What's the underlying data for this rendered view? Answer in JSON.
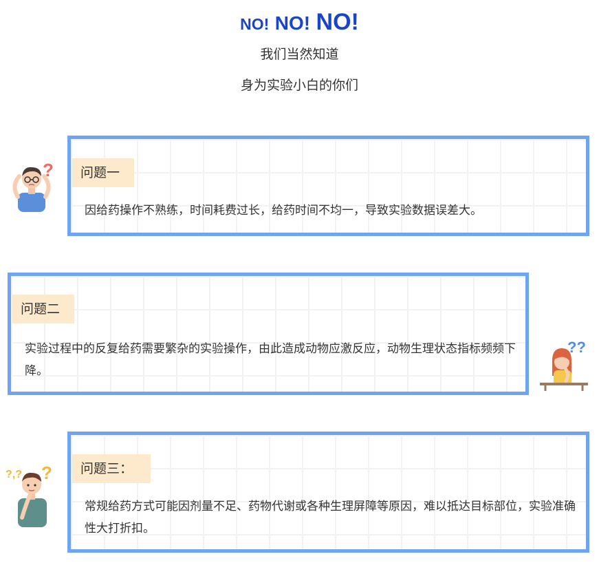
{
  "header": {
    "no_small": "NO!",
    "no_medium": "NO!",
    "no_large": "NO!",
    "line1": "我们当然知道",
    "line2": "身为实验小白的你们"
  },
  "problems": [
    {
      "tag": "问题一",
      "text": "因给药操作不熟练，时间耗费过长，给药时间不均一，导致实验数据误差大。",
      "avatar": "confused-boy-icon"
    },
    {
      "tag": "问题二",
      "text": "实验过程中的反复给药需要繁杂的实验操作，由此造成动物应激反应，动物生理状态指标频频下降。",
      "avatar": "thinking-girl-icon"
    },
    {
      "tag": "问题三：",
      "text": "常规给药方式可能因剂量不足、药物代谢或各种生理屏障等原因，难以抵达目标部位，实验准确性大打折扣。",
      "avatar": "pondering-man-icon"
    }
  ],
  "colors": {
    "title_blue": "#1a45c9",
    "card_border": "#6fa4f3",
    "tag_bg": "#fde9cc"
  }
}
